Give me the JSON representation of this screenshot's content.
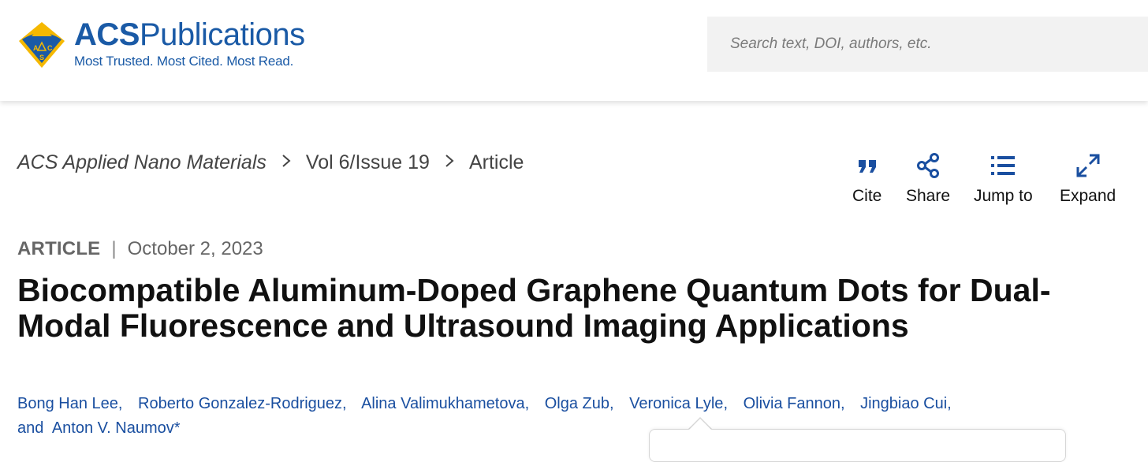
{
  "brand": {
    "acs": "ACS",
    "publications": "Publications",
    "tagline": "Most Trusted. Most Cited. Most Read.",
    "emblem_letters": [
      "A",
      "C",
      "S"
    ],
    "color": "#1a5aa6",
    "emblem_color": "#f5b800"
  },
  "search": {
    "placeholder": "Search text, DOI, authors, etc."
  },
  "breadcrumb": {
    "journal": "ACS Applied Nano Materials",
    "volume": "Vol 6/Issue 19",
    "current": "Article",
    "separator_icon": "chevron-right-icon"
  },
  "tools": [
    {
      "label": "Cite",
      "icon": "quote-icon"
    },
    {
      "label": "Share",
      "icon": "share-icon"
    },
    {
      "label": "Jump to",
      "icon": "list-icon"
    },
    {
      "label": "Expand",
      "icon": "expand-icon"
    }
  ],
  "article": {
    "type": "ARTICLE",
    "date": "October 2, 2023",
    "title": "Biocompatible Aluminum-Doped Graphene Quantum Dots for Dual-Modal Fluorescence and Ultrasound Imaging Applications",
    "authors": [
      "Bong Han Lee",
      "Roberto Gonzalez-Rodriguez",
      "Alina Valimukhametova",
      "Olga Zub",
      "Veronica Lyle",
      "Olivia Fannon",
      "Jingbiao Cui"
    ],
    "and_word": "and",
    "last_author": "Anton V. Naumov*"
  },
  "colors": {
    "link": "#1a4fa0",
    "icon": "#1a4fa0",
    "search_bg": "#f2f2f2"
  }
}
